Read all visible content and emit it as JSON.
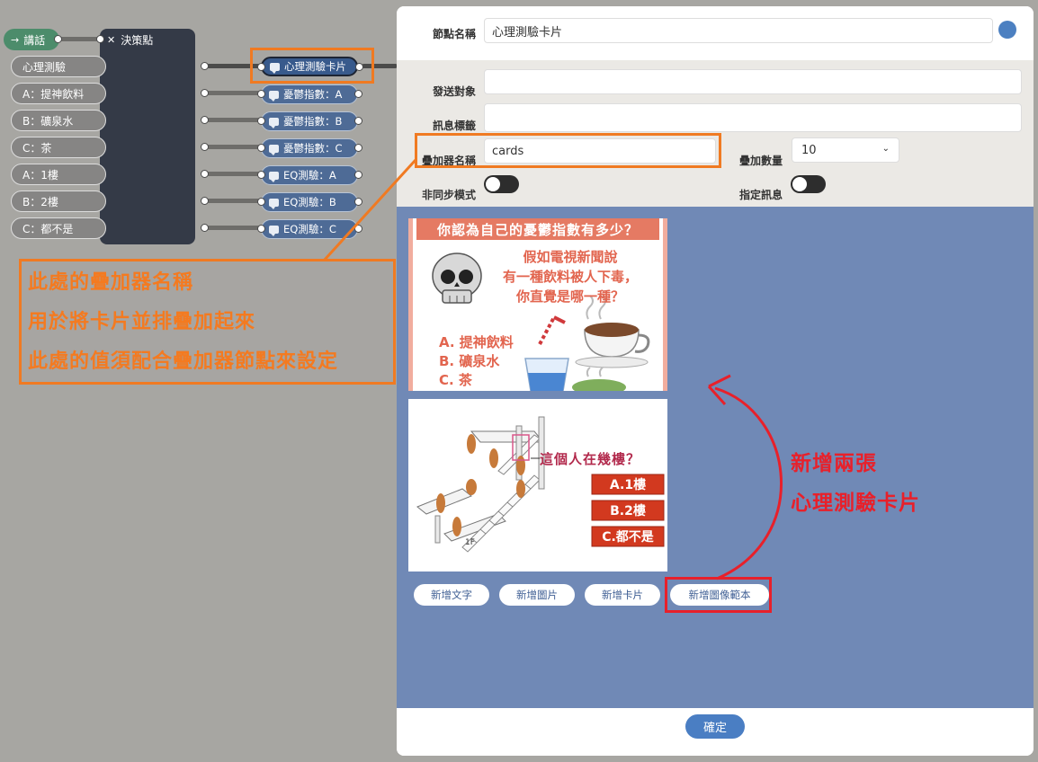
{
  "flow": {
    "conversation_node": {
      "label": "講話"
    },
    "decision_node": {
      "title": "決策點",
      "options": [
        "心理測驗",
        "A：提神飲料",
        "B：礦泉水",
        "C：茶",
        "A：1樓",
        "B：2樓",
        "C：都不是"
      ]
    },
    "card_nodes": [
      "心理測驗卡片",
      "憂鬱指數：A",
      "憂鬱指數：B",
      "憂鬱指數：C",
      "EQ測驗：A",
      "EQ測驗：B",
      "EQ測驗：C"
    ]
  },
  "annotation_stacker": {
    "lines": [
      "此處的疊加器名稱",
      "用於將卡片並排疊加起來",
      "此處的值須配合疊加器節點來設定"
    ]
  },
  "annotation_cards": {
    "lines": [
      "新增兩張",
      "心理測驗卡片"
    ]
  },
  "dialog": {
    "node_name_label": "節點名稱",
    "node_name_value": "心理測驗卡片",
    "send_to_label": "發送對象",
    "send_to_value": "",
    "msg_tag_label": "訊息標籤",
    "msg_tag_value": "",
    "stacker_name_label": "疊加器名稱",
    "stacker_name_value": "cards",
    "stack_count_label": "疊加數量",
    "stack_count_value": "10",
    "async_label": "非同步模式",
    "assign_msg_label": "指定訊息",
    "card1": {
      "title": "你認為自己的憂鬱指數有多少？",
      "question": [
        "假如電視新聞說",
        "有一種飲料被人下毒，",
        "你直覺是哪一種？"
      ],
      "options": [
        "A. 提神飲料",
        "B. 礦泉水",
        "C. 茶"
      ]
    },
    "card2": {
      "question": "這個人在幾樓？",
      "options": [
        "A.1樓",
        "B.2樓",
        "C.都不是"
      ],
      "floor_label": "1F"
    },
    "buttons": [
      "新增文字",
      "新增圖片",
      "新增卡片",
      "新增圖像範本"
    ],
    "confirm": "確定"
  },
  "colors": {
    "canvas": "#a7a6a2",
    "card_area": "#7089b6",
    "annotation_orange": "#f07a22",
    "annotation_red": "#e8202a",
    "node_blue": "#4e6b96",
    "node_green": "#4c8c6b"
  }
}
